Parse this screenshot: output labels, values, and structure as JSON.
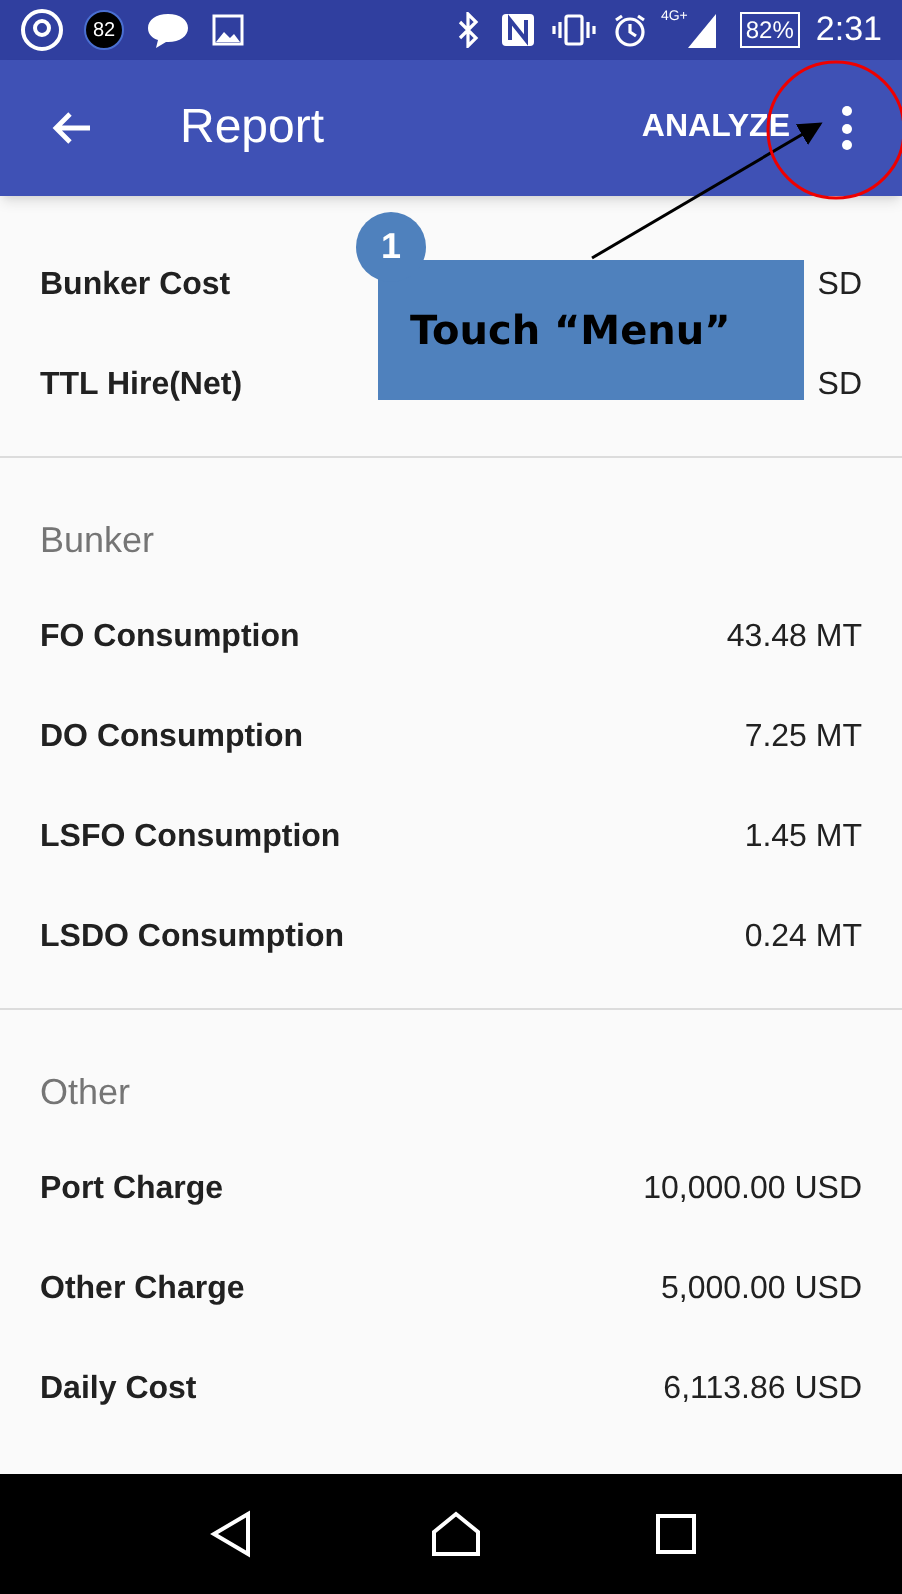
{
  "status_bar": {
    "badge": "82",
    "battery": "82%",
    "network": "4G+",
    "time": "2:31"
  },
  "app_bar": {
    "title": "Report",
    "action": "ANALYZE"
  },
  "sections": [
    {
      "rows": [
        {
          "label": "Bunker Cost",
          "value": "SD"
        },
        {
          "label": "TTL Hire(Net)",
          "value": "SD"
        }
      ]
    },
    {
      "header": "Bunker",
      "rows": [
        {
          "label": "FO Consumption",
          "value": "43.48 MT"
        },
        {
          "label": "DO Consumption",
          "value": "7.25 MT"
        },
        {
          "label": "LSFO Consumption",
          "value": "1.45 MT"
        },
        {
          "label": "LSDO Consumption",
          "value": "0.24 MT"
        }
      ]
    },
    {
      "header": "Other",
      "rows": [
        {
          "label": "Port Charge",
          "value": "10,000.00 USD"
        },
        {
          "label": "Other Charge",
          "value": "5,000.00 USD"
        },
        {
          "label": "Daily Cost",
          "value": "6,113.86 USD"
        }
      ]
    }
  ],
  "annotation": {
    "step": "1",
    "text": "Touch “Menu”"
  }
}
